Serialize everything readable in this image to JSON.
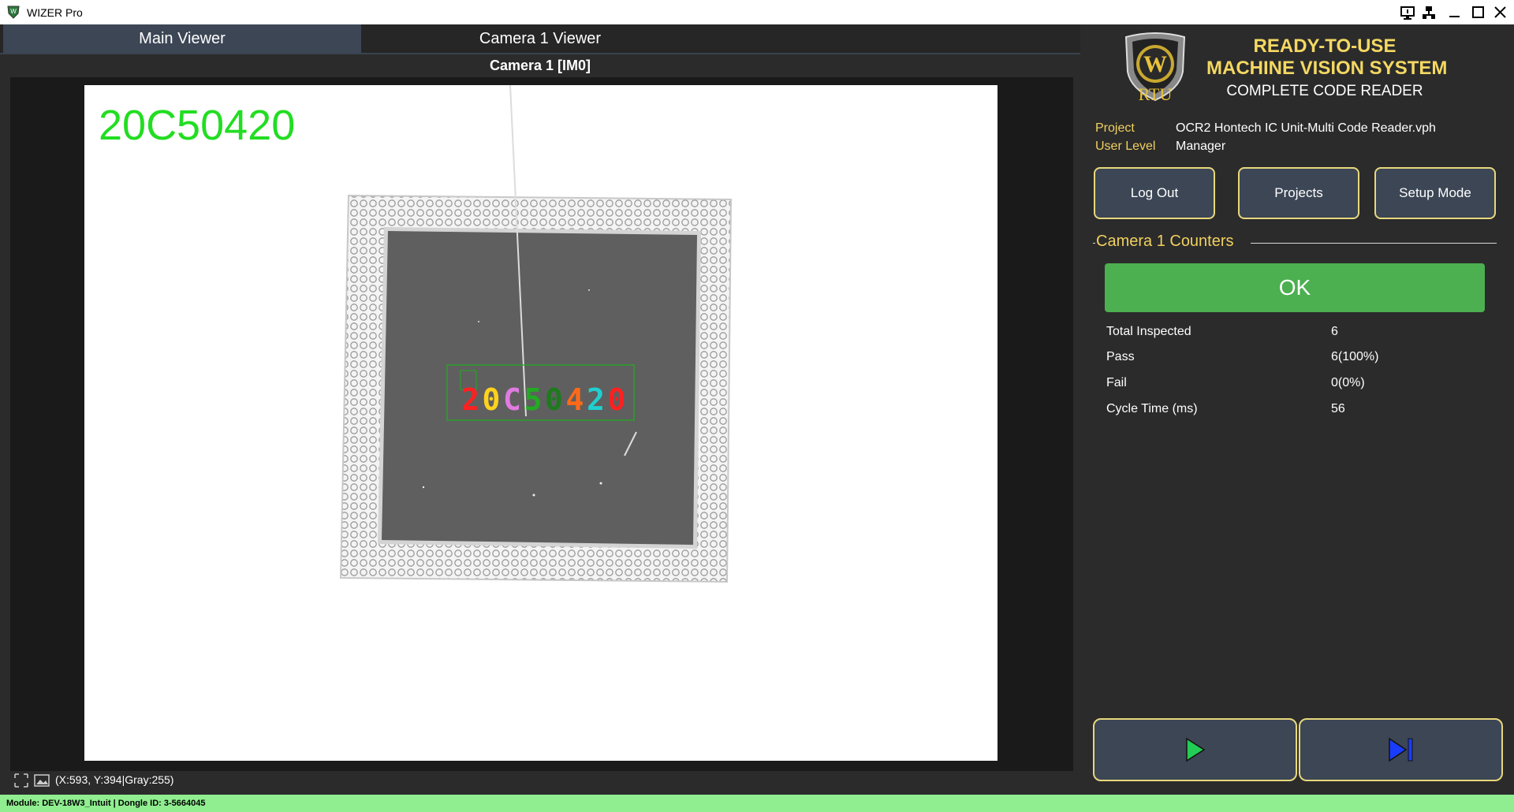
{
  "window": {
    "title": "WIZER Pro",
    "icons": [
      "app-shield-icon",
      "monitor-icon",
      "network-icon",
      "minimize-icon",
      "maximize-icon",
      "close-icon"
    ]
  },
  "tabs": [
    {
      "label": "Main Viewer",
      "active": true
    },
    {
      "label": "Camera 1 Viewer",
      "active": false
    }
  ],
  "viewer": {
    "caption": "Camera 1  [IM0]",
    "ocr_result": "20C50420",
    "ocr_result_color": "#22dd22",
    "roi_color": "#22aa22",
    "characters": [
      {
        "char": "2",
        "color": "#ff2020"
      },
      {
        "char": "0",
        "color": "#ffd21e"
      },
      {
        "char": "C",
        "color": "#e07be0"
      },
      {
        "char": "5",
        "color": "#22aa22"
      },
      {
        "char": "0",
        "color": "#1e7a1e"
      },
      {
        "char": "4",
        "color": "#ff6a1a"
      },
      {
        "char": "2",
        "color": "#20cfcf"
      },
      {
        "char": "0",
        "color": "#ff2020"
      }
    ],
    "status_icons": [
      "fit-view-icon",
      "image-icon"
    ],
    "pixel_readout": "(X:593, Y:394|Gray:255)"
  },
  "brand": {
    "logo_text": "RTU",
    "line1": "READY-TO-USE",
    "line2": "MACHINE VISION SYSTEM",
    "line3": "COMPLETE CODE READER",
    "accent_color": "#f4d862"
  },
  "info": {
    "project_label": "Project",
    "project_value": "OCR2 Hontech IC Unit-Multi Code Reader.vph",
    "user_level_label": "User Level",
    "user_level_value": "Manager"
  },
  "buttons": {
    "logout": "Log Out",
    "projects": "Projects",
    "setup": "Setup Mode"
  },
  "counters": {
    "title": "Camera 1 Counters",
    "status": "OK",
    "status_color": "#4caf50",
    "rows": [
      {
        "label": "Total Inspected",
        "value": "6"
      },
      {
        "label": "Pass",
        "value": "6(100%)"
      },
      {
        "label": "Fail",
        "value": "0(0%)"
      },
      {
        "label": "Cycle Time (ms)",
        "value": "56"
      }
    ]
  },
  "controls": {
    "run_icon": "play-icon",
    "run_color": "#22cc55",
    "step_icon": "step-forward-icon",
    "step_color": "#1a3cff"
  },
  "statusbar": {
    "text": "Module: DEV-18W3_Intuit | Dongle ID: 3-5664045"
  }
}
